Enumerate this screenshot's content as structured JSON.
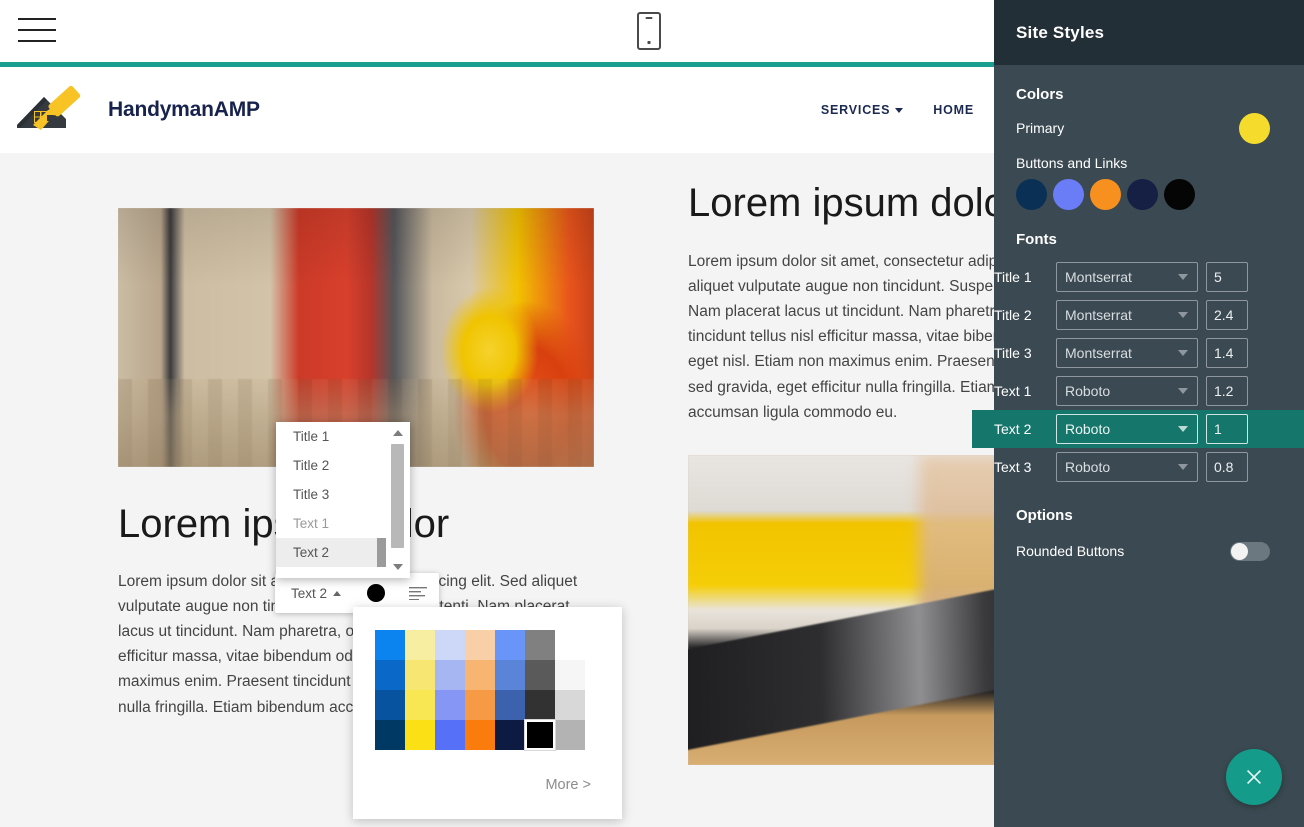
{
  "browser_bar": {
    "menu_icon": "hamburger-icon",
    "device_preview_icon": "mobile-device-icon"
  },
  "site_header": {
    "brand_name": "HandymanAMP",
    "logo_icon": "house-paint-roller-logo",
    "nav": [
      {
        "label": "SERVICES",
        "has_dropdown": true
      },
      {
        "label": "HOME",
        "has_dropdown": false
      }
    ]
  },
  "canvas": {
    "left_column": {
      "image_alt": "warehouse worker in orange safety suit and yellow face shield",
      "heading": "Lorem ipsum dolor",
      "paragraph": "Lorem ipsum dolor sit amet, consectetur adipiscing elit. Sed aliquet vulputate augue non tincidunt. Suspendisse potenti. Nam placerat lacus ut tincidunt. Nam pharetra, odio vitae tincidunt tellus nisl efficitur massa, vitae bibendum odio nisl eget nisl. Etiam non maximus enim. Praesent tincidunt nulla sed gravida, eget efficitur nulla fringilla. Etiam bibendum accumsan ligula commodo eu."
    },
    "right_column": {
      "heading": "Lorem ipsum dolor",
      "paragraph": "Lorem ipsum dolor sit amet, consectetur adipiscing elit. Sed aliquet vulputate augue non tincidunt. Suspendisse potenti. Nam placerat lacus ut tincidunt. Nam pharetra, odio vitae tincidunt tellus nisl efficitur massa, vitae bibendum odio nisl eget nisl. Etiam non maximus enim. Praesent tincidunt nulla sed gravida, eget efficitur nulla fringilla. Etiam bibendum accumsan ligula commodo eu.",
      "image_alt": "adjustable wrench and nail on a wooden board"
    }
  },
  "mini_toolbar": {
    "style_label": "Text 2",
    "color_swatch": "#000000",
    "align_icon": "align-left-icon"
  },
  "style_dropdown": {
    "items": [
      {
        "label": "Title 1",
        "state": "normal"
      },
      {
        "label": "Title 2",
        "state": "normal"
      },
      {
        "label": "Title 3",
        "state": "normal"
      },
      {
        "label": "Text 1",
        "state": "disabled"
      },
      {
        "label": "Text 2",
        "state": "selected"
      }
    ],
    "brush_icon": "paintbrush-icon",
    "scroll_up_icon": "caret-up-icon",
    "scroll_down_icon": "caret-down-icon"
  },
  "palette_popup": {
    "more_label": "More >",
    "selected_color": "#000000",
    "rows": [
      [
        "#0b84ef",
        "#f8eea2",
        "#cdd7f7",
        "#f9cfa8",
        "#6895f7",
        "#808080",
        "#ffffff"
      ],
      [
        "#0a68c8",
        "#f7e772",
        "#a6b6f2",
        "#f8b471",
        "#5a84d8",
        "#5a5a5a",
        "#f6f6f6"
      ],
      [
        "#08539f",
        "#f9e653",
        "#8596f5",
        "#f79a46",
        "#3c62ad",
        "#323232",
        "#d8d8d8"
      ],
      [
        "#003963",
        "#fbe016",
        "#5671f7",
        "#f97c0c",
        "#0d1b43",
        "#000000",
        "#b3b3b3"
      ]
    ]
  },
  "sidebar": {
    "title": "Site Styles",
    "sections": {
      "colors_heading": "Colors",
      "primary_label": "Primary",
      "primary_color": "#f5dc2c",
      "buttons_links_label": "Buttons and Links",
      "button_colors": [
        "#0b3055",
        "#6a7df7",
        "#f7901e",
        "#161f44",
        "#050505"
      ],
      "fonts_heading": "Fonts",
      "font_rows": [
        {
          "label": "Title 1",
          "font": "Montserrat",
          "size": "5",
          "active": false
        },
        {
          "label": "Title 2",
          "font": "Montserrat",
          "size": "2.4",
          "active": false
        },
        {
          "label": "Title 3",
          "font": "Montserrat",
          "size": "1.4",
          "active": false
        },
        {
          "label": "Text 1",
          "font": "Roboto",
          "size": "1.2",
          "active": false
        },
        {
          "label": "Text 2",
          "font": "Roboto",
          "size": "1",
          "active": true
        },
        {
          "label": "Text 3",
          "font": "Roboto",
          "size": "0.8",
          "active": false
        }
      ],
      "options_heading": "Options",
      "rounded_buttons_label": "Rounded Buttons",
      "rounded_buttons_on": false
    },
    "close_icon": "close-x-icon",
    "accent_color": "#159b8a"
  }
}
